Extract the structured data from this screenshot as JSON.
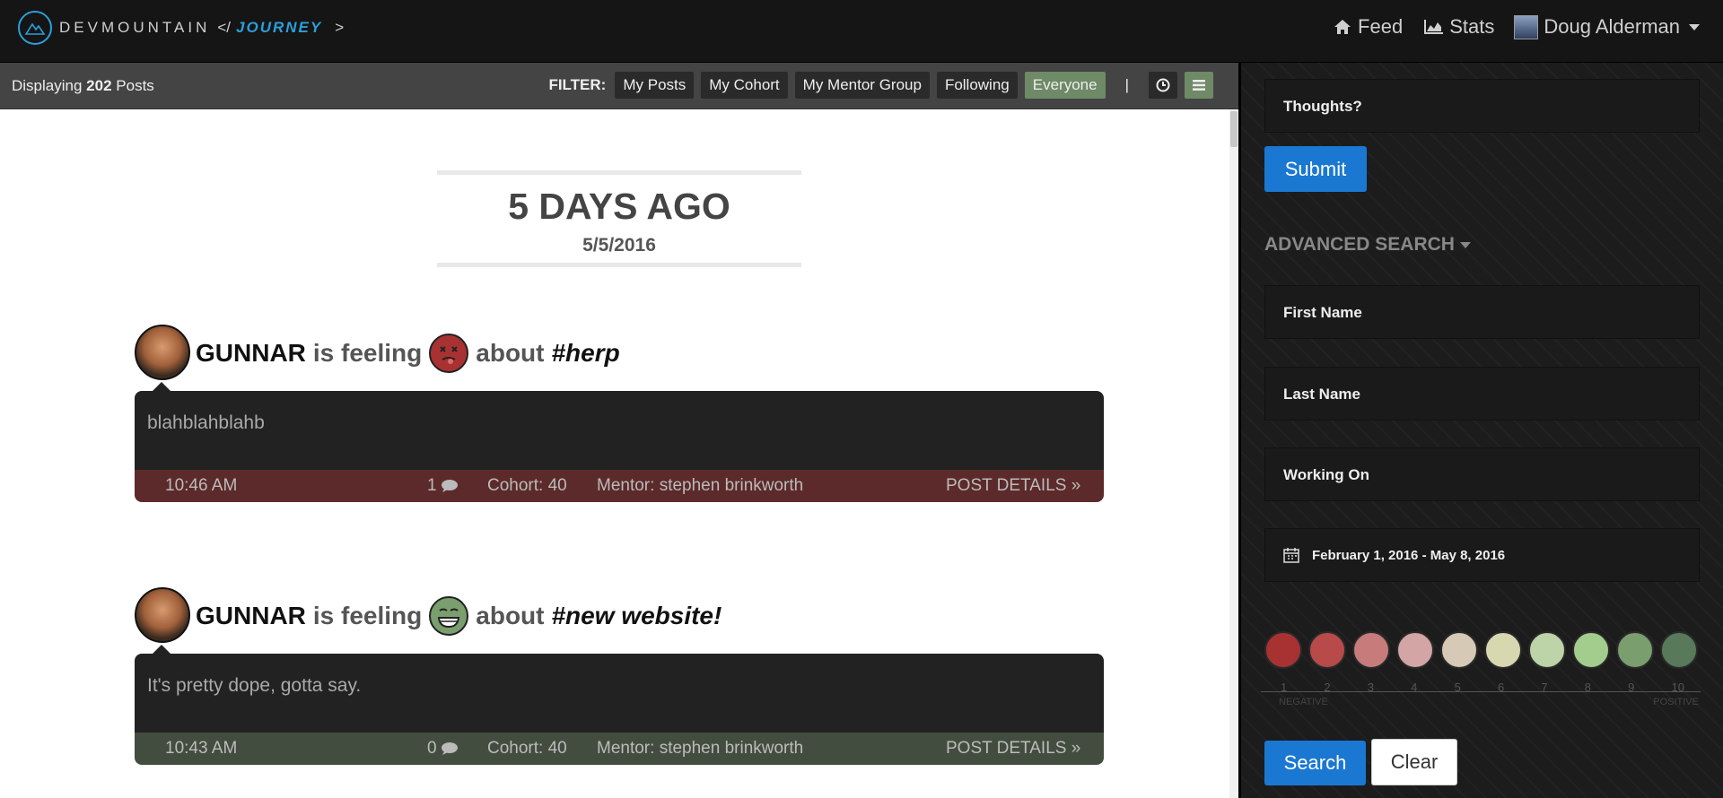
{
  "brand": {
    "name": "DEVMOUNTAIN",
    "code_open": "</",
    "journey": "JOURNEY",
    "code_close": ">"
  },
  "nav": {
    "feed": "Feed",
    "stats": "Stats",
    "user": "Doug Alderman"
  },
  "filterbar": {
    "displaying_prefix": "Displaying",
    "count": "202",
    "displaying_suffix": "Posts",
    "filter_label": "FILTER:",
    "filters": [
      "My Posts",
      "My Cohort",
      "My Mentor Group",
      "Following",
      "Everyone"
    ],
    "active_filter": "Everyone",
    "separator": "|"
  },
  "date_header": {
    "relative": "5 DAYS AGO",
    "absolute": "5/5/2016"
  },
  "posts": [
    {
      "author": "GUNNAR",
      "feeling_text": "is feeling",
      "about_text": "about",
      "tag": "#herp",
      "mood": 1,
      "body": "blahblahblahb",
      "time": "10:46 AM",
      "comments": "1",
      "cohort": "Cohort: 40",
      "mentor": "Mentor: stephen brinkworth",
      "details": "POST DETAILS »",
      "footer_color": "#5c2a2a"
    },
    {
      "author": "GUNNAR",
      "feeling_text": "is feeling",
      "about_text": "about",
      "tag": "#new website!",
      "mood": 9,
      "body": "It's pretty dope, gotta say.",
      "time": "10:43 AM",
      "comments": "0",
      "cohort": "Cohort: 40",
      "mentor": "Mentor: stephen brinkworth",
      "details": "POST DETAILS »",
      "footer_color": "#434d3f"
    }
  ],
  "panel": {
    "thoughts_placeholder": "Thoughts?",
    "submit": "Submit",
    "advanced_search": "ADVANCED SEARCH",
    "first_name": "First Name",
    "last_name": "Last Name",
    "working_on": "Working On",
    "date_range": "February 1, 2016 - May 8, 2016",
    "scale": [
      "1",
      "2",
      "3",
      "4",
      "5",
      "6",
      "7",
      "8",
      "9",
      "10"
    ],
    "negative": "NEGATIVE",
    "positive": "POSITIVE",
    "search": "Search",
    "clear": "Clear"
  },
  "mood_colors": [
    "#a83232",
    "#b84a4a",
    "#c77b7b",
    "#d4a5a5",
    "#d6c9b5",
    "#d7d8b0",
    "#bcd4a8",
    "#a3cd8d",
    "#7a9e6e",
    "#58795a"
  ],
  "colors": {
    "accent": "#1a78d2",
    "active_filter": "#6f8a66"
  }
}
